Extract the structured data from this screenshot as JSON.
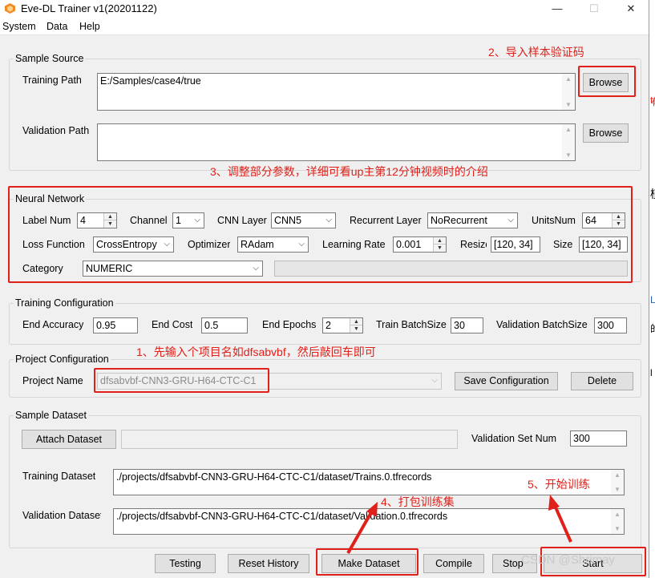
{
  "window": {
    "title": "Eve-DL Trainer v1(20201122)",
    "minimize": "—",
    "maximize": "☐",
    "close": "✕"
  },
  "menu": [
    "System",
    "Data",
    "Help"
  ],
  "sample_source": {
    "title": "Sample Source",
    "training_path_label": "Training Path",
    "training_path_value": "E:/Samples/case4/true",
    "browse_label": "Browse",
    "validation_path_label": "Validation Path",
    "validation_path_value": "",
    "browse2_label": "Browse"
  },
  "neural_network": {
    "title": "Neural Network",
    "label_num_label": "Label Num",
    "label_num_value": "4",
    "channel_label": "Channel",
    "channel_value": "1",
    "cnn_layer_label": "CNN Layer",
    "cnn_layer_value": "CNN5",
    "recurrent_label": "Recurrent Layer",
    "recurrent_value": "NoRecurrent",
    "units_label": "UnitsNum",
    "units_value": "64",
    "loss_label": "Loss Function",
    "loss_value": "CrossEntropy",
    "optimizer_label": "Optimizer",
    "optimizer_value": "RAdam",
    "lr_label": "Learning Rate",
    "lr_value": "0.001",
    "resize_label": "Resize",
    "resize_value": "[120, 34]",
    "size_label": "Size",
    "size_value": "[120, 34]",
    "category_label": "Category",
    "category_value": "NUMERIC"
  },
  "training_configuration": {
    "title": "Training Configuration",
    "end_acc_label": "End Accuracy",
    "end_acc_value": "0.95",
    "end_cost_label": "End Cost",
    "end_cost_value": "0.5",
    "end_epochs_label": "End Epochs",
    "end_epochs_value": "2",
    "train_bs_label": "Train BatchSize",
    "train_bs_value": "30",
    "val_bs_label": "Validation BatchSize",
    "val_bs_value": "300"
  },
  "project_configuration": {
    "title": "Project Configuration",
    "name_label": "Project Name",
    "name_value": "dfsabvbf-CNN3-GRU-H64-CTC-C1",
    "save_label": "Save Configuration",
    "delete_label": "Delete"
  },
  "sample_dataset": {
    "title": "Sample Dataset",
    "attach_label": "Attach Dataset",
    "val_set_label": "Validation Set Num",
    "val_set_value": "300",
    "training_ds_label": "Training Dataset",
    "training_ds_value": "./projects/dfsabvbf-CNN3-GRU-H64-CTC-C1/dataset/Trains.0.tfrecords",
    "validation_ds_label": "Validation Dataset",
    "validation_ds_value": "./projects/dfsabvbf-CNN3-GRU-H64-CTC-C1/dataset/Validation.0.tfrecords"
  },
  "buttons": {
    "testing": "Testing",
    "reset_history": "Reset History",
    "make_dataset": "Make Dataset",
    "compile": "Compile",
    "stop": "Stop",
    "start": "Start"
  },
  "annotations": {
    "a1": "1、先输入个项目名如dfsabvbf，然后敲回车即可",
    "a2": "2、导入样本验证码",
    "a3": "3、调整部分参数，详细可看up主第12分钟视频时的介绍",
    "a4": "4、打包训练集",
    "a5": "5、开始训练"
  },
  "watermark": "CSDN @Shrimay",
  "right_edge": [
    "t",
    "有",
    "植",
    "L",
    "的",
    "l"
  ],
  "colors": {
    "annotation": "#e0201a",
    "window_bg": "#f0f0f0"
  }
}
